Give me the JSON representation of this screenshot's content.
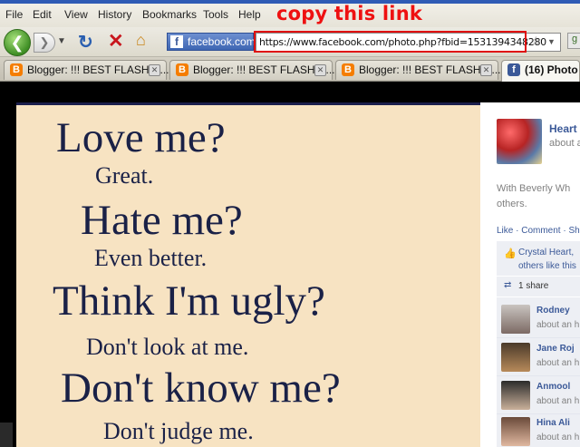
{
  "menubar": {
    "items": [
      "File",
      "Edit",
      "View",
      "History",
      "Bookmarks",
      "Tools",
      "Help"
    ]
  },
  "annotation": "copy this link",
  "navbar": {
    "identity": "facebook.com",
    "url": "https://www.facebook.com/photo.php?fbid=1531394348280"
  },
  "tabs": [
    {
      "title": "Blogger: !!! BEST FLASH C...",
      "icon": "blogger-icon"
    },
    {
      "title": "Blogger: !!! BEST FLASH C...",
      "icon": "blogger-icon"
    },
    {
      "title": "Blogger: !!! BEST FLASH C...",
      "icon": "blogger-icon"
    },
    {
      "title": "(16) Photo",
      "icon": "facebook-icon",
      "active": true
    }
  ],
  "photo": {
    "lines": [
      "Love me?",
      "Great.",
      "Hate me?",
      "Even better.",
      "Think I'm ugly?",
      "Don't look at me.",
      "Don't know me?",
      "Don't judge me."
    ]
  },
  "sidebar": {
    "page_name": "Heart",
    "page_meta": "about a",
    "caption_line1": "With Beverly Wh",
    "caption_line2": "others.",
    "actions": "Like · Comment · Sh",
    "likes_line1": "Crystal Heart,",
    "likes_line2": "others like this",
    "shares": "1 share",
    "commenters": [
      {
        "name": "Rodney",
        "meta": "about an h"
      },
      {
        "name": "Jane Roj",
        "meta": "about an h"
      },
      {
        "name": "Anmool",
        "meta": "about an h"
      },
      {
        "name": "Hina Ali",
        "meta": "about an h"
      }
    ]
  },
  "colors": {
    "annotation": "#ee1111",
    "facebook_blue": "#3b5998",
    "photo_background": "#f7e3c2",
    "photo_text": "#1a2147"
  }
}
